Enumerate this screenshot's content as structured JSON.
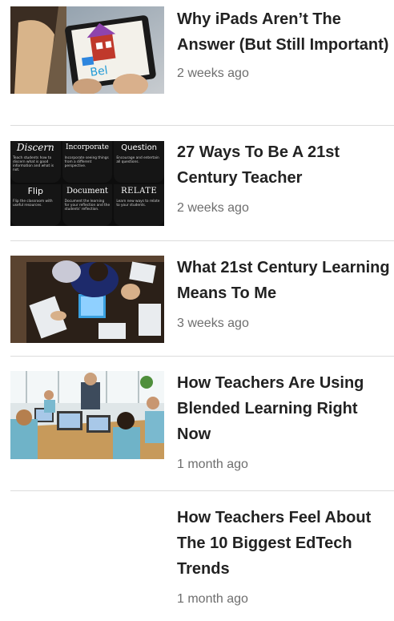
{
  "articles": [
    {
      "title": "Why iPads Aren’t The Answer (But Still Important)",
      "date": "2 weeks ago"
    },
    {
      "title": "27 Ways To Be A 21st Century Teacher",
      "date": "2 weeks ago",
      "slide": {
        "cells": [
          {
            "head": "Discern",
            "sub": "Teach students how to discern what is good information and what is not."
          },
          {
            "head": "Incorporate",
            "sub": "Incorporate seeing things from a different perspective."
          },
          {
            "head": "Question",
            "sub": "Encourage and entertain all questions."
          },
          {
            "head": "Flip",
            "sub": "Flip the classroom with useful resources."
          },
          {
            "head": "Document",
            "sub": "Document the learning for your reflection and the students' reflection."
          },
          {
            "head": "RELATE",
            "sub": "Learn new ways to relate to your students."
          }
        ]
      }
    },
    {
      "title": "What 21st Century Learning Means To Me",
      "date": "3 weeks ago"
    },
    {
      "title": "How Teachers Are Using Blended Learning Right Now",
      "date": "1 month ago"
    },
    {
      "title": "How Teachers Feel About The 10 Biggest EdTech Trends",
      "date": "1 month ago"
    }
  ]
}
